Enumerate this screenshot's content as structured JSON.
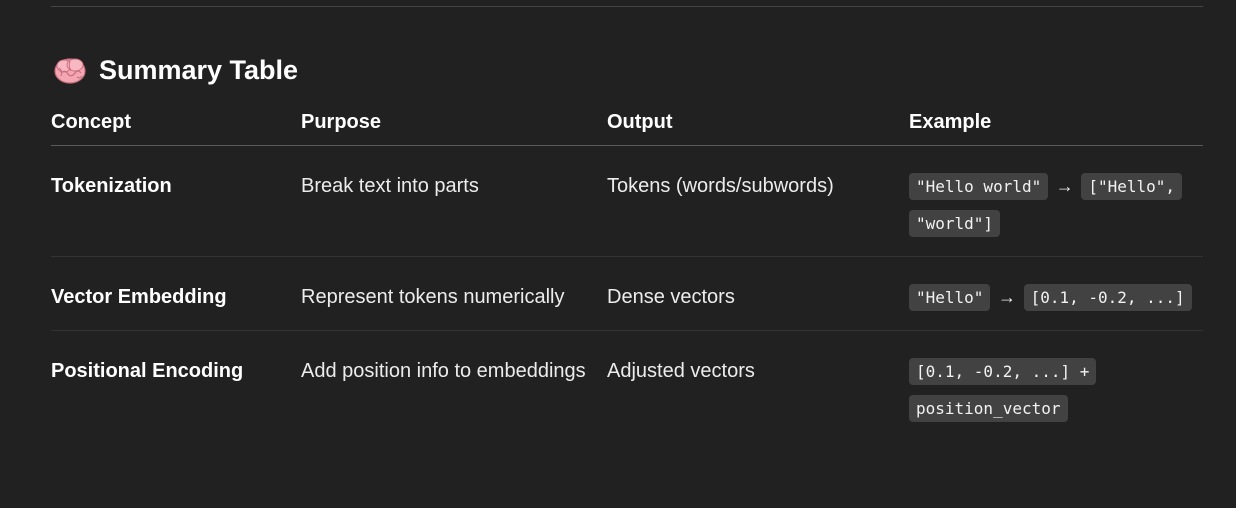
{
  "section": {
    "icon": "brain-icon",
    "title": "Summary Table"
  },
  "table": {
    "headers": [
      "Concept",
      "Purpose",
      "Output",
      "Example"
    ],
    "rows": [
      {
        "concept": "Tokenization",
        "purpose": "Break text into parts",
        "output": "Tokens (words/subwords)",
        "example": {
          "code1": "\"Hello world\"",
          "arrow": "→",
          "code2": "[\"Hello\", \"world\"]"
        }
      },
      {
        "concept": "Vector Embedding",
        "purpose": "Represent tokens numerically",
        "output": "Dense vectors",
        "example": {
          "code1": "\"Hello\"",
          "arrow": "→",
          "code2": "[0.1, -0.2, ...]"
        }
      },
      {
        "concept": "Positional Encoding",
        "purpose": "Add position info to embeddings",
        "output": "Adjusted vectors",
        "example": {
          "code1": "[0.1, -0.2, ...] + position_vector"
        }
      }
    ]
  }
}
